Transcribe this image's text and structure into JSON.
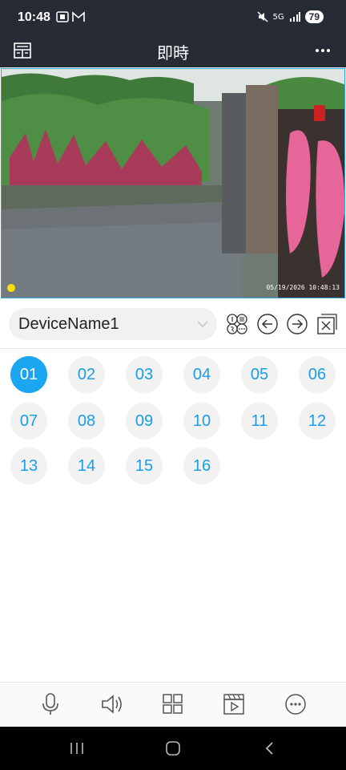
{
  "status_bar": {
    "time": "10:48",
    "network": "5G",
    "battery": "79"
  },
  "header": {
    "title": "即時"
  },
  "video": {
    "timestamp": "05/19/2026 10:48:13"
  },
  "device": {
    "name": "DeviceName1"
  },
  "channels": {
    "active": "01",
    "items": [
      "01",
      "02",
      "03",
      "04",
      "05",
      "06",
      "07",
      "08",
      "09",
      "10",
      "11",
      "12",
      "13",
      "14",
      "15",
      "16"
    ]
  },
  "icons": {
    "status": [
      "screenshot-icon",
      "gmail-icon",
      "mute-icon",
      "signal-icon"
    ],
    "header": [
      "layout-icon",
      "more-icon"
    ],
    "tools": [
      "split-view-icon",
      "previous-icon",
      "next-icon",
      "close-all-icon"
    ],
    "toolbar": [
      "microphone-icon",
      "speaker-icon",
      "grid-icon",
      "playback-icon",
      "more-options-icon"
    ],
    "nav": [
      "recent-apps-icon",
      "home-icon",
      "back-icon"
    ]
  },
  "colors": {
    "header_bg": "#272b36",
    "accent": "#1aa6f0",
    "channel_text": "#1a9ee8"
  }
}
